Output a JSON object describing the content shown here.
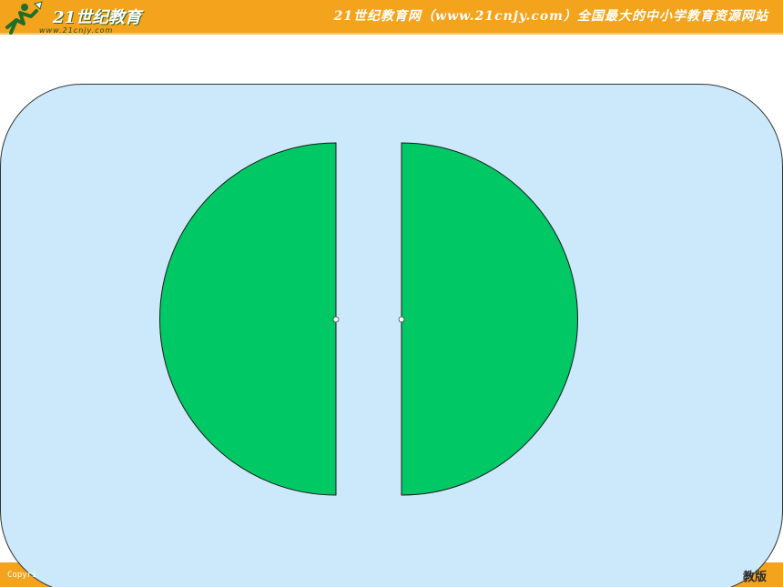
{
  "header": {
    "logo_name": "21世纪教育",
    "logo_url": "www.21cnjy.com",
    "site_title": "21世纪教育网（www.21cnjy.com）全国最大的中小学教育资源网站"
  },
  "footer": {
    "copyright": "Copyri",
    "edition": "教版"
  },
  "colors": {
    "header_bar": "#f4a31c",
    "panel_fill": "#cce9fc",
    "semicircle_fill": "#00c864"
  },
  "figure": {
    "shape": "circle cut into two semicircles",
    "pieces": [
      "left-semicircle",
      "right-semicircle"
    ]
  }
}
